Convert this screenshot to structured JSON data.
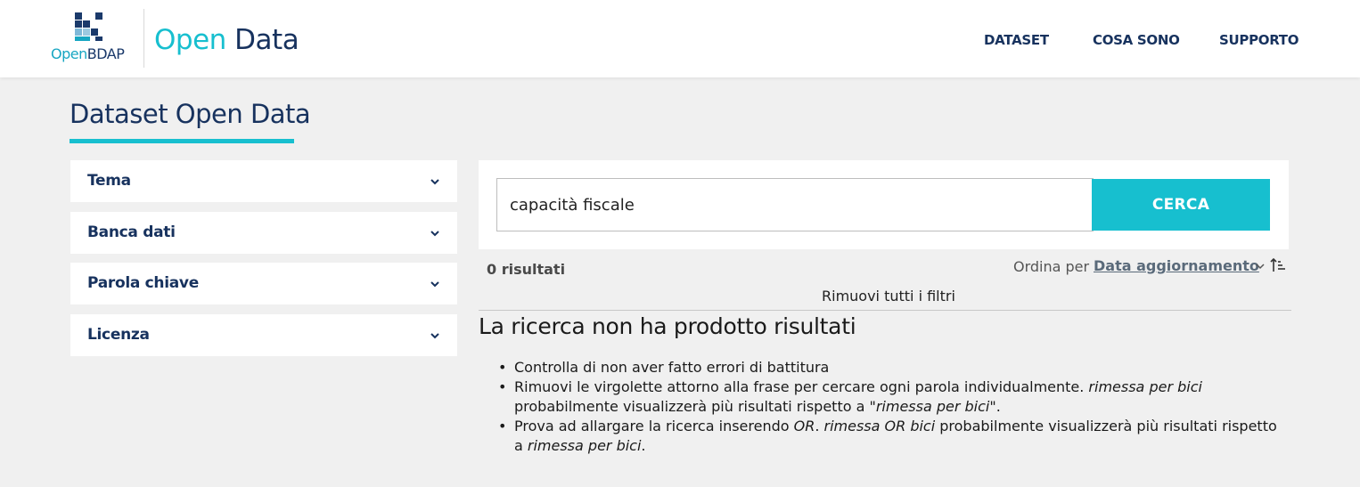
{
  "header": {
    "logo_text_open": "Open",
    "logo_text_bdap": "BDAP",
    "title_part1": "Open",
    "title_part2": "Data",
    "nav": [
      "DATASET",
      "COSA SONO",
      "SUPPORTO"
    ]
  },
  "page": {
    "title": "Dataset Open Data"
  },
  "filters": [
    {
      "label": "Tema",
      "icon": "chevron-down-icon"
    },
    {
      "label": "Banca dati",
      "icon": "chevron-down-icon"
    },
    {
      "label": "Parola chiave",
      "icon": "chevron-down-icon"
    },
    {
      "label": "Licenza",
      "icon": "chevron-down-icon"
    }
  ],
  "search": {
    "value": "capacità fiscale",
    "button_label": "CERCA"
  },
  "results": {
    "count_text": "0 risultati",
    "sort_label": "Ordina per",
    "sort_value": "Data aggiornamento",
    "remove_filters": "Rimuovi tutti i filtri"
  },
  "no_results": {
    "title": "La ricerca non ha prodotto risultati",
    "tip1": "Controlla di non aver fatto errori di battitura",
    "tip2_a": "Rimuovi le virgolette attorno alla frase per cercare ogni parola individualmente. ",
    "tip2_b": "rimessa per bici",
    "tip2_c": " probabilmente visualizzerà più risultati rispetto a ",
    "tip2_d": "\"rimessa per bici\"",
    "tip2_e": ".",
    "tip3_a": "Prova ad allargare la ricerca inserendo ",
    "tip3_b": "OR",
    "tip3_c": ". ",
    "tip3_d": "rimessa OR bici",
    "tip3_e": " probabilmente visualizzerà più risultati rispetto a ",
    "tip3_f": "rimessa per bici",
    "tip3_g": "."
  },
  "colors": {
    "accent": "#17bfcf",
    "navy": "#17325e",
    "background": "#f0f0f0"
  }
}
